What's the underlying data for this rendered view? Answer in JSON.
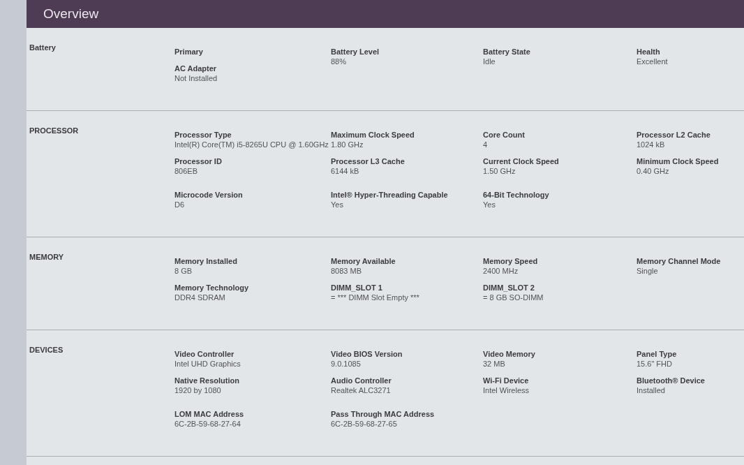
{
  "header": {
    "title": "Overview"
  },
  "sections": [
    {
      "title": "Battery",
      "columns": [
        [
          {
            "label": "Primary"
          },
          {
            "label": "AC Adapter",
            "value": "Not Installed"
          }
        ],
        [
          {
            "label": "Battery Level",
            "value": "88%"
          }
        ],
        [
          {
            "label": "Battery State",
            "value": "Idle"
          }
        ],
        [
          {
            "label": "Health",
            "value": "Excellent"
          }
        ]
      ]
    },
    {
      "title": "PROCESSOR",
      "columns": [
        [
          {
            "label": "Processor Type",
            "value": "Intel(R) Core(TM) i5-8265U CPU @ 1.60GHz"
          },
          {
            "label": "Processor ID",
            "value": "806EB"
          },
          {
            "label": "Microcode Version",
            "value": "D6"
          }
        ],
        [
          {
            "label": "Maximum Clock Speed",
            "value": "1.80 GHz"
          },
          {
            "label": "Processor L3 Cache",
            "value": "6144 kB"
          },
          {
            "label": "Intel® Hyper-Threading Capable",
            "value": "Yes"
          }
        ],
        [
          {
            "label": "Core Count",
            "value": "4"
          },
          {
            "label": "Current Clock Speed",
            "value": "1.50 GHz"
          },
          {
            "label": "64-Bit Technology",
            "value": "Yes"
          }
        ],
        [
          {
            "label": "Processor L2 Cache",
            "value": "1024 kB"
          },
          {
            "label": "Minimum Clock Speed",
            "value": "0.40 GHz"
          }
        ]
      ]
    },
    {
      "title": "MEMORY",
      "columns": [
        [
          {
            "label": "Memory Installed",
            "value": "8 GB"
          },
          {
            "label": "Memory Technology",
            "value": "DDR4 SDRAM"
          }
        ],
        [
          {
            "label": "Memory Available",
            "value": "8083 MB"
          },
          {
            "label": "DIMM_SLOT 1",
            "value": "= *** DIMM Slot Empty ***"
          }
        ],
        [
          {
            "label": "Memory Speed",
            "value": "2400 MHz"
          },
          {
            "label": "DIMM_SLOT 2",
            "value": "= 8 GB SO-DIMM"
          }
        ],
        [
          {
            "label": "Memory Channel Mode",
            "value": "Single"
          }
        ]
      ]
    },
    {
      "title": "DEVICES",
      "columns": [
        [
          {
            "label": "Video Controller",
            "value": "Intel UHD Graphics"
          },
          {
            "label": "Native Resolution",
            "value": "1920 by 1080"
          },
          {
            "label": "LOM MAC Address",
            "value": "6C-2B-59-68-27-64"
          }
        ],
        [
          {
            "label": "Video BIOS Version",
            "value": "9.0.1085"
          },
          {
            "label": "Audio Controller",
            "value": "Realtek ALC3271"
          },
          {
            "label": "Pass Through MAC Address",
            "value": "6C-2B-59-68-27-65"
          }
        ],
        [
          {
            "label": "Video Memory",
            "value": "32 MB"
          },
          {
            "label": "Wi-Fi Device",
            "value": "Intel Wireless"
          }
        ],
        [
          {
            "label": "Panel Type",
            "value": "15.6\" FHD"
          },
          {
            "label": "Bluetooth® Device",
            "value": "Installed"
          }
        ]
      ]
    }
  ]
}
